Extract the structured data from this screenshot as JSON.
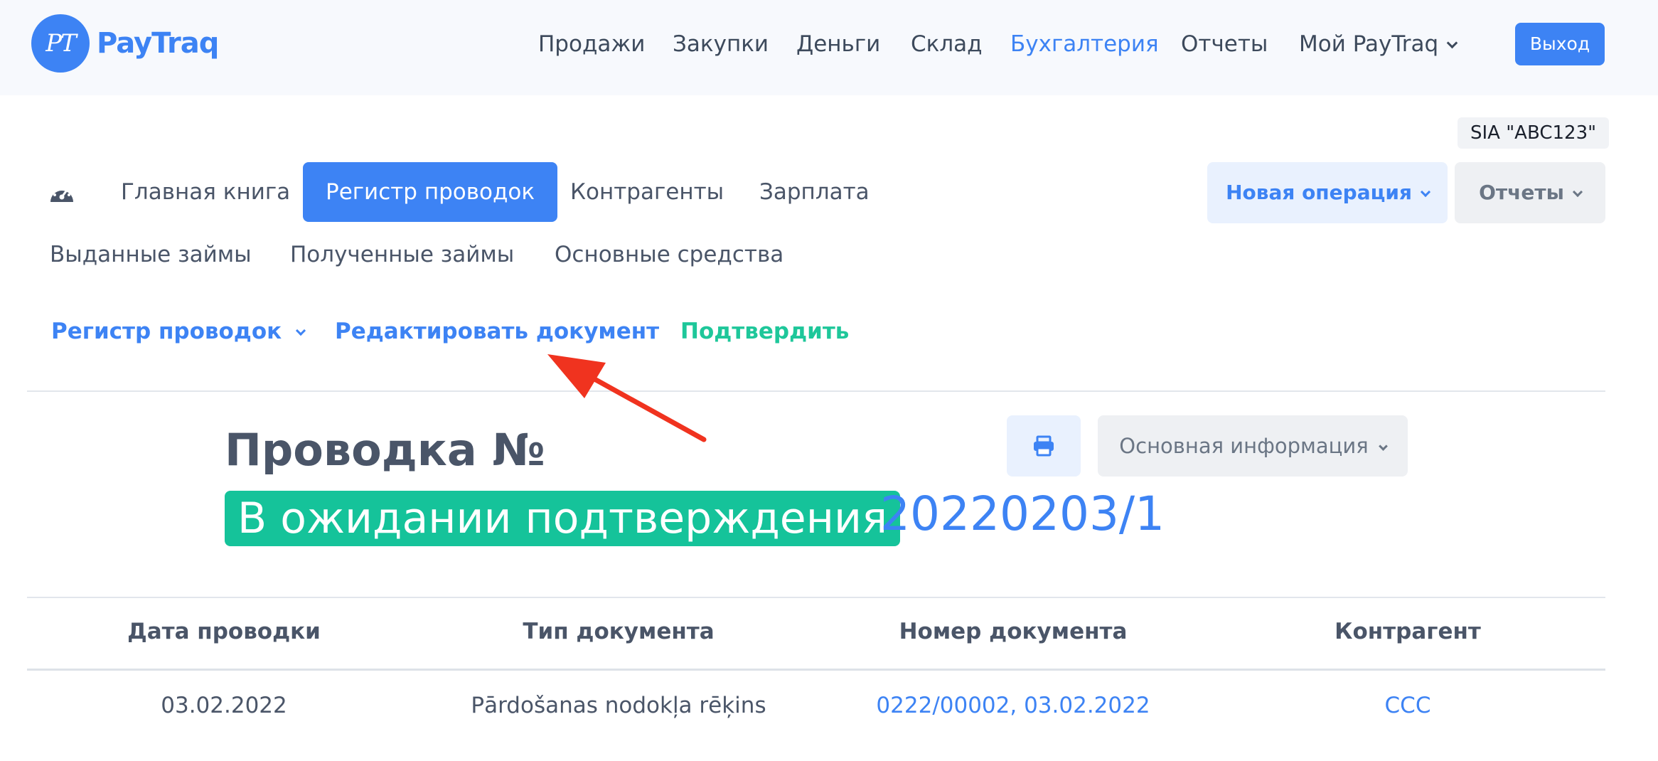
{
  "header": {
    "logo_mark": "PT",
    "logo_text": "PayTraq",
    "nav": {
      "sales": "Продажи",
      "purchases": "Закупки",
      "money": "Деньги",
      "warehouse": "Склад",
      "accounting": "Бухгалтерия",
      "reports": "Отчеты",
      "my_paytraq": "Мой PayTraq"
    },
    "logout": "Выход"
  },
  "company": "SIA \"ABC123\"",
  "tabs": {
    "dashboard_icon": "gauge-icon",
    "general_ledger": "Главная книга",
    "journal_register": "Регистр проводок",
    "counterparties": "Контрагенты",
    "payroll": "Зарплата",
    "loans_issued": "Выданные займы",
    "loans_received": "Полученные займы",
    "fixed_assets": "Основные средства"
  },
  "buttons": {
    "new_operation": "Новая операция",
    "reports": "Отчеты"
  },
  "actions": {
    "register": "Регистр проводок",
    "edit_document": "Редактировать документ",
    "confirm": "Подтвердить"
  },
  "entry": {
    "title": "Проводка №",
    "status": "В ожидании подтверждения",
    "number": "20220203/1",
    "info_button": "Основная информация",
    "print_icon": "printer-icon"
  },
  "table": {
    "headers": [
      "Дата проводки",
      "Тип документа",
      "Номер документа",
      "Контрагент"
    ],
    "rows": [
      [
        "03.02.2022",
        "Pārdošanas nodokļa rēķins",
        "0222/00002, 03.02.2022",
        "CCC"
      ]
    ]
  },
  "colors": {
    "accent": "#3d83f4",
    "status_green": "#15c39a",
    "annotation_arrow": "#f0331f"
  }
}
